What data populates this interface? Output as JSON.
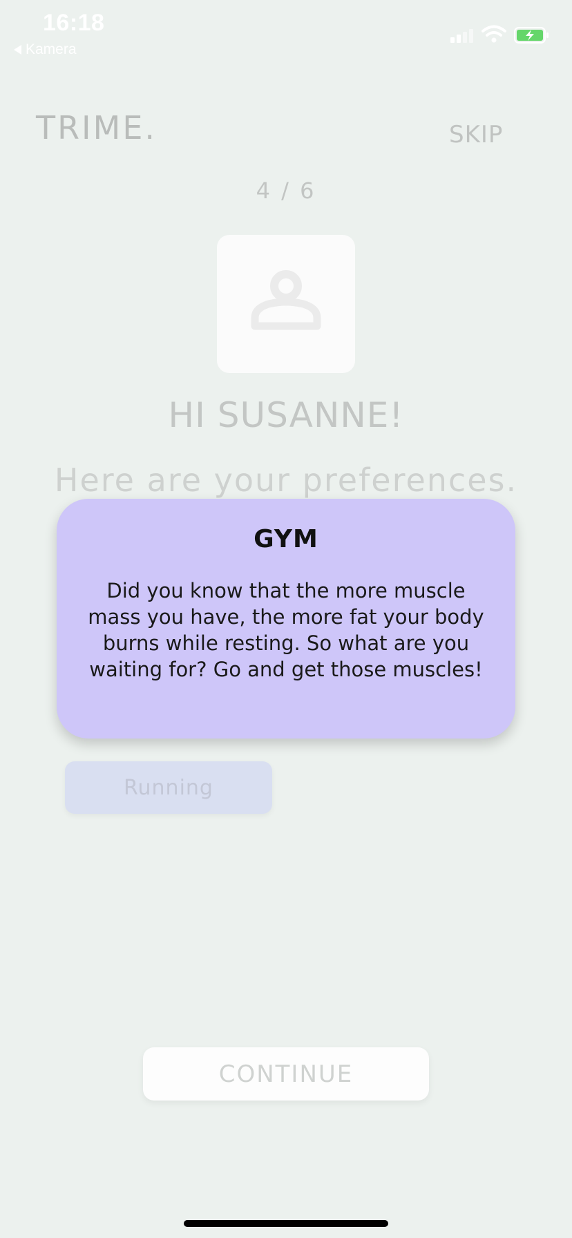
{
  "status_bar": {
    "time": "16:18",
    "back_label": "Kamera",
    "icons": [
      "signal-icon",
      "wifi-icon",
      "battery-charging-icon"
    ]
  },
  "header": {
    "logo": "TRIME.",
    "skip_label": "SKIP"
  },
  "onboarding": {
    "step_indicator": "4 / 6",
    "avatar_icon": "user-icon",
    "greeting": "HI SUSANNE!",
    "subtitle": "Here are your preferences."
  },
  "popup": {
    "title": "GYM",
    "body": "Did you know that the more muscle mass you have, the more fat your body burns while resting. So what are you waiting for? Go and get those muscles!"
  },
  "preferences": [
    {
      "label": "Running"
    }
  ],
  "footer": {
    "continue_label": "CONTINUE"
  },
  "colors": {
    "background": "#ecf1ee",
    "popup": "#cec6f9",
    "chip": "#d9dff1",
    "battery_green": "#65d66a"
  }
}
